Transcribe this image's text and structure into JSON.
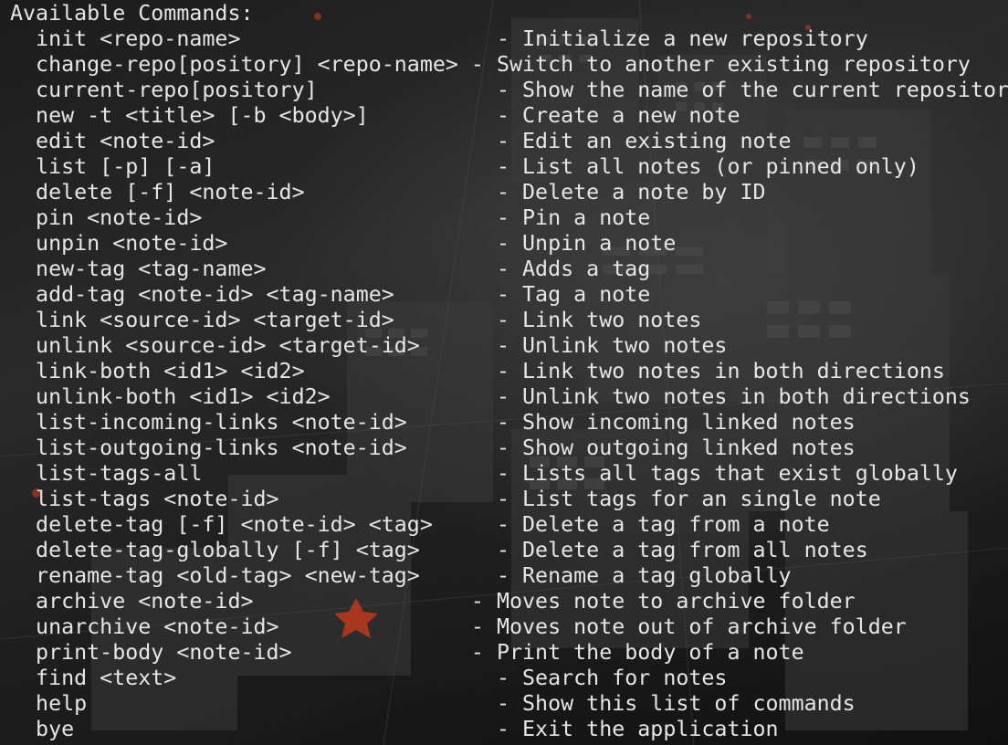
{
  "terminal": {
    "lines": [
      "Available Commands:",
      "  init <repo-name>                    - Initialize a new repository",
      "  change-repo[pository] <repo-name> - Switch to another existing repository",
      "  current-repo[pository]              - Show the name of the current repository",
      "  new -t <title> [-b <body>]          - Create a new note",
      "  edit <note-id>                      - Edit an existing note",
      "  list [-p] [-a]                      - List all notes (or pinned only)",
      "  delete [-f] <note-id>               - Delete a note by ID",
      "  pin <note-id>                       - Pin a note",
      "  unpin <note-id>                     - Unpin a note",
      "  new-tag <tag-name>                  - Adds a tag",
      "  add-tag <note-id> <tag-name>        - Tag a note",
      "  link <source-id> <target-id>        - Link two notes",
      "  unlink <source-id> <target-id>      - Unlink two notes",
      "  link-both <id1> <id2>               - Link two notes in both directions",
      "  unlink-both <id1> <id2>             - Unlink two notes in both directions",
      "  list-incoming-links <note-id>       - Show incoming linked notes",
      "  list-outgoing-links <note-id>       - Show outgoing linked notes",
      "  list-tags-all                       - Lists all tags that exist globally",
      "  list-tags <note-id>                 - List tags for an single note",
      "  delete-tag [-f] <note-id> <tag>     - Delete a tag from a note",
      "  delete-tag-globally [-f] <tag>      - Delete a tag from all notes",
      "  rename-tag <old-tag> <new-tag>      - Rename a tag globally",
      "  archive <note-id>                 - Moves note to archive folder",
      "  unarchive <note-id>               - Moves note out of archive folder",
      "  print-body <note-id>              - Print the body of a note",
      "  find <text>                         - Search for notes",
      "  help                                - Show this list of commands",
      "  bye                                 - Exit the application"
    ]
  },
  "colors": {
    "background": "#141414",
    "text": "#e6e6e6",
    "accent": "#c0391f"
  }
}
